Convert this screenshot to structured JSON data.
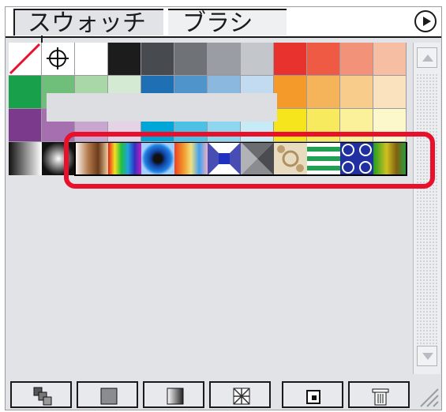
{
  "tabs": {
    "swatches": "スウォッチ",
    "brushes": "ブラシ"
  },
  "icons": {
    "menu": "panel-menu-triangle",
    "show_all": "show-all-swatches-icon",
    "show_color": "show-color-swatches-icon",
    "show_gradient": "show-gradient-swatches-icon",
    "show_pattern": "show-pattern-swatches-icon",
    "new_swatch": "new-swatch-icon",
    "delete": "trash-icon"
  },
  "colors": {
    "highlight": "#e8102a",
    "panel_bg": "#e2e3e6"
  },
  "swatch_rows": [
    [
      "none",
      "registration",
      "#ffffff",
      "#1c1c1c",
      "#474a4e",
      "#6f7378",
      "#9a9ea4",
      "#c3c6ca",
      "#e8322e",
      "#ee5a44",
      "#f29278",
      "#f6bfa4"
    ],
    [
      "#19a04b",
      "#6fbf7a",
      "#a9d7a8",
      "#d4ead2",
      "#1f6fb4",
      "#4f95cc",
      "#8bb8df",
      "#c2dbf0",
      "#f49a2a",
      "#f6b45a",
      "#f8cd8c",
      "#fbe2bf"
    ],
    [
      "#7b3a8c",
      "#a66fb0",
      "#c9a6cf",
      "#e4d3e7",
      "#00a6d8",
      "#4dc0e6",
      "#8fd6ef",
      "#c6ebf7",
      "#f6e41c",
      "#f8ea5e",
      "#fbf19a",
      "#fdf7cc"
    ]
  ]
}
